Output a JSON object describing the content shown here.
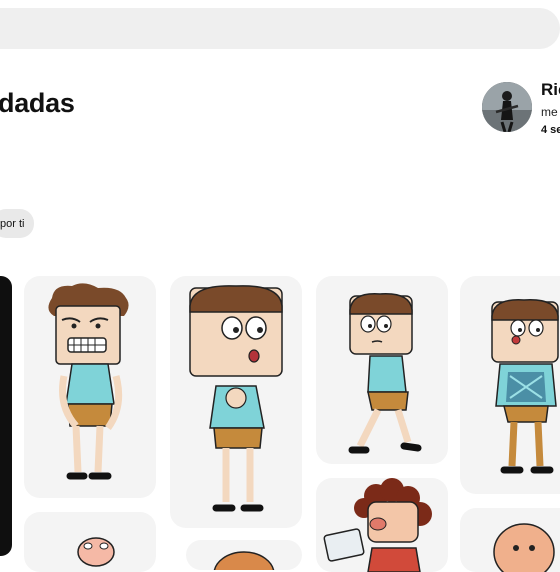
{
  "header": {
    "board_title": "dadas"
  },
  "profile": {
    "name": "Ric",
    "handle": "me",
    "followers": "4 se"
  },
  "filters": {
    "chip_label": "por ti"
  },
  "pins": [
    {
      "icon": "cartoon-character-grimacing"
    },
    {
      "icon": "cartoon-character-surprised"
    },
    {
      "icon": "cartoon-character-walking"
    },
    {
      "icon": "cartoon-character-sweater"
    },
    {
      "icon": "cartoon-character-curly-hair"
    }
  ],
  "colors": {
    "search_bar": "#efefef",
    "chip_bg": "#e9e9e9",
    "pin_bg": "#f4f4f4"
  }
}
